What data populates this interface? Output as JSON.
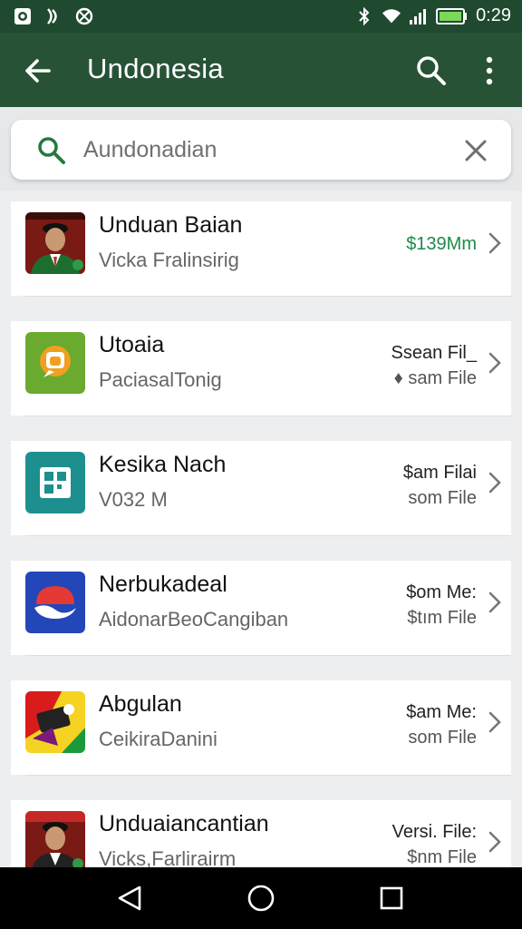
{
  "status_bar": {
    "time": "0:29",
    "icons": [
      "camera-icon",
      "signal-icon",
      "sync-icon",
      "bluetooth-icon",
      "wifi-icon",
      "cell-signal-icon",
      "battery-icon"
    ]
  },
  "app_bar": {
    "title": "Undonesia",
    "back_icon": "arrow-back-icon",
    "search_icon": "search-icon",
    "more_icon": "more-vert-icon"
  },
  "search": {
    "value": "Aundonadian"
  },
  "list": [
    {
      "title": "Unduan Baian",
      "subtitle": "Vicka Fralinsirig",
      "meta_top": "",
      "meta_bottom": "$139Mm",
      "icon": "portrait-icon"
    },
    {
      "title": "Utoaia",
      "subtitle": "PaciasalTonig",
      "meta_top": "Ssean Fil_",
      "meta_bottom": "♦ sam File",
      "icon": "chat-bubble-icon"
    },
    {
      "title": "Kesika Nach",
      "subtitle": "V032 M",
      "meta_top": "$am Filai",
      "meta_bottom": "som File",
      "icon": "grid-icon"
    },
    {
      "title": "Nerbukadeal",
      "subtitle": "AidonarBeoCangiban",
      "meta_top": "$om Me:",
      "meta_bottom": "$tım File",
      "icon": "flag-logo-icon"
    },
    {
      "title": "Abgulan",
      "subtitle": "CeikiraDanini",
      "meta_top": "$am Me:",
      "meta_bottom": "som File",
      "icon": "sticker-icon"
    },
    {
      "title": "Unduaiancantian",
      "subtitle": "Vicks,Farlirairm",
      "meta_top": "Versi. File:",
      "meta_bottom": "$nm File",
      "icon": "portrait-icon"
    }
  ],
  "nav_bar": {
    "icons": [
      "nav-back-icon",
      "nav-home-icon",
      "nav-recents-icon"
    ]
  },
  "colors": {
    "app_bar": "#275236",
    "status_bar": "#1f4a30",
    "accent_green": "#1e8a4a"
  }
}
